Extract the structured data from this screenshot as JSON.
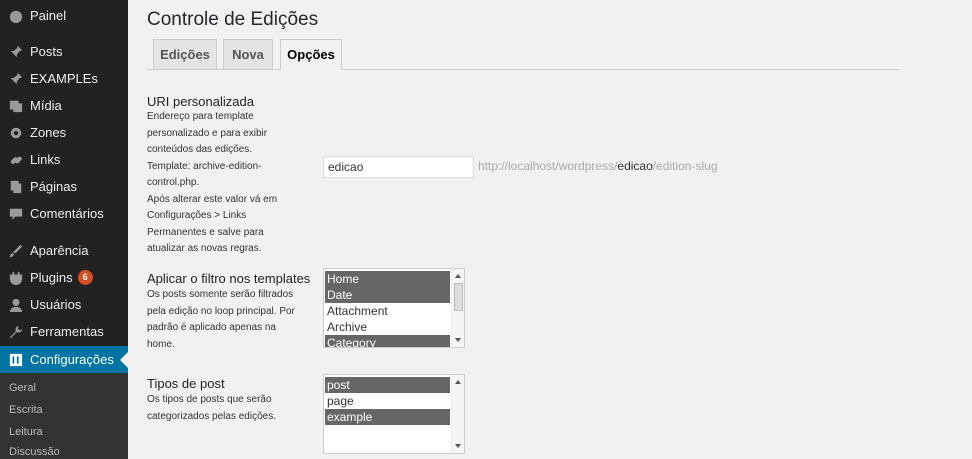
{
  "sidebar": {
    "items": [
      {
        "label": "Painel",
        "icon": "dashboard-icon"
      },
      {
        "label": "Posts",
        "icon": "pin-icon"
      },
      {
        "label": "EXAMPLEs",
        "icon": "pin-icon"
      },
      {
        "label": "Mídia",
        "icon": "media-icon"
      },
      {
        "label": "Zones",
        "icon": "gear-icon"
      },
      {
        "label": "Links",
        "icon": "link-icon"
      },
      {
        "label": "Páginas",
        "icon": "pages-icon"
      },
      {
        "label": "Comentários",
        "icon": "comment-icon"
      },
      {
        "label": "Aparência",
        "icon": "brush-icon"
      },
      {
        "label": "Plugins",
        "icon": "plugin-icon",
        "badge": "6"
      },
      {
        "label": "Usuários",
        "icon": "user-icon"
      },
      {
        "label": "Ferramentas",
        "icon": "wrench-icon"
      },
      {
        "label": "Configurações",
        "icon": "settings-icon",
        "active": true
      }
    ],
    "submenu": [
      "Geral",
      "Escrita",
      "Leitura",
      "Discussão"
    ]
  },
  "page": {
    "title": "Controle de Edições",
    "tabs": [
      "Edições",
      "Nova",
      "Opções"
    ],
    "active_tab": "Opções"
  },
  "uri_section": {
    "title": "URI personalizada",
    "description": [
      "Endereço para template",
      "personalizado e para exibir",
      "conteúdos das edições.",
      "Template: archive-edition-",
      "control.php.",
      "Após alterar este valor vá em",
      "Configurações > Links",
      "Permanentes e salve para",
      "atualizar as novas regras."
    ],
    "input_value": "edicao",
    "preview_prefix": "http://localhost/wordpress/",
    "preview_highlight": "edicao",
    "preview_suffix": "/edition-slug"
  },
  "templates_section": {
    "title": "Aplicar o filtro nos templates",
    "description": [
      "Os posts somente serão filtrados",
      "pela edição no loop principal. Por",
      "padrão é aplicado apenas na",
      "home."
    ],
    "options": [
      {
        "label": "Home",
        "selected": true
      },
      {
        "label": "Date",
        "selected": true
      },
      {
        "label": "Attachment",
        "selected": false
      },
      {
        "label": "Archive",
        "selected": false
      },
      {
        "label": "Category",
        "selected": true
      }
    ]
  },
  "post_types_section": {
    "title": "Tipos de post",
    "description": [
      "Os tipos de posts que serão",
      "categorizados pelas edições."
    ],
    "options": [
      {
        "label": "post",
        "selected": true
      },
      {
        "label": "page",
        "selected": false
      },
      {
        "label": "example",
        "selected": true
      }
    ]
  },
  "colors": {
    "sidebar_bg": "#222222",
    "active_menu": "#0074a2",
    "badge": "#d54e21",
    "selected_option": "#666666"
  }
}
